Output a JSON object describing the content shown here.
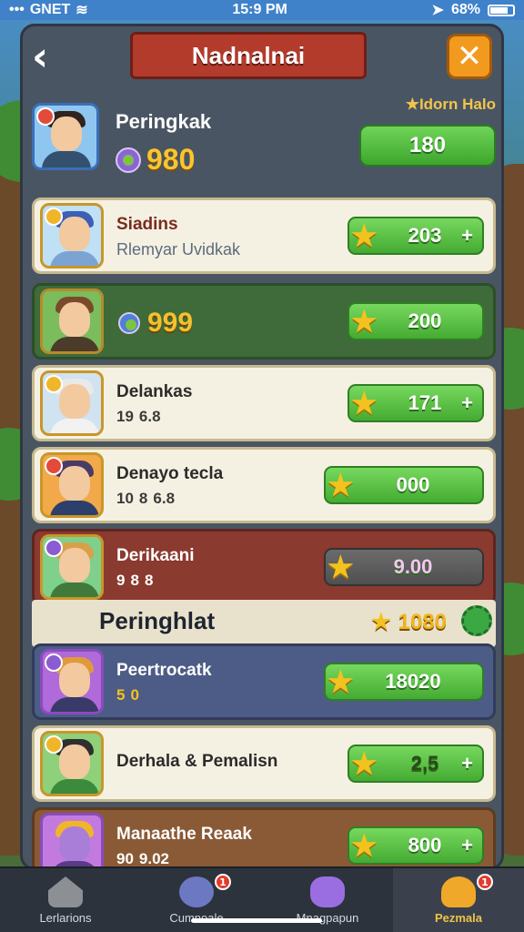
{
  "status": {
    "carrier": "GNET",
    "time": "15:9 PM",
    "battery": "68%"
  },
  "header": {
    "title": "Nadnalnai"
  },
  "profile": {
    "name": "Peringkak",
    "score": "980",
    "tag": "Idorn Halo",
    "button_value": "180"
  },
  "rows": [
    {
      "title": "Siadins",
      "subtitle": "Rlemyar Uvidkak",
      "score": "203",
      "plus": "+"
    },
    {
      "big_score": "999",
      "score": "200"
    },
    {
      "title": "Delankas",
      "stats": [
        "19",
        "6.8"
      ],
      "score": "171",
      "plus": "+"
    },
    {
      "title": "Denayo tecla",
      "stats": [
        "10",
        "8",
        "6.8"
      ],
      "score": "000"
    },
    {
      "title": "Derikaani",
      "stats": [
        "9",
        "8",
        "8"
      ],
      "score": "9.00"
    }
  ],
  "section": {
    "title": "Peringhlat",
    "score": "1080"
  },
  "rows2": [
    {
      "title": "Peertrocatk",
      "stats": [
        "5",
        "0"
      ],
      "score": "18020"
    },
    {
      "title": "Derhala & Pemalisn",
      "score": "2,5",
      "plus": "+"
    },
    {
      "title": "Manaathe Reaak",
      "stats": [
        "90",
        "9.02"
      ],
      "score": "800",
      "plus": "+"
    }
  ],
  "nav": [
    {
      "label": "Lerlarions"
    },
    {
      "label": "Cumnoale",
      "badge": "1"
    },
    {
      "label": "Mnagpapun"
    },
    {
      "label": "Pezmala",
      "badge": "1"
    }
  ],
  "colors": {
    "accent_green": "#44ab32",
    "banner_red": "#b33b2c",
    "gold": "#f2c12e"
  }
}
